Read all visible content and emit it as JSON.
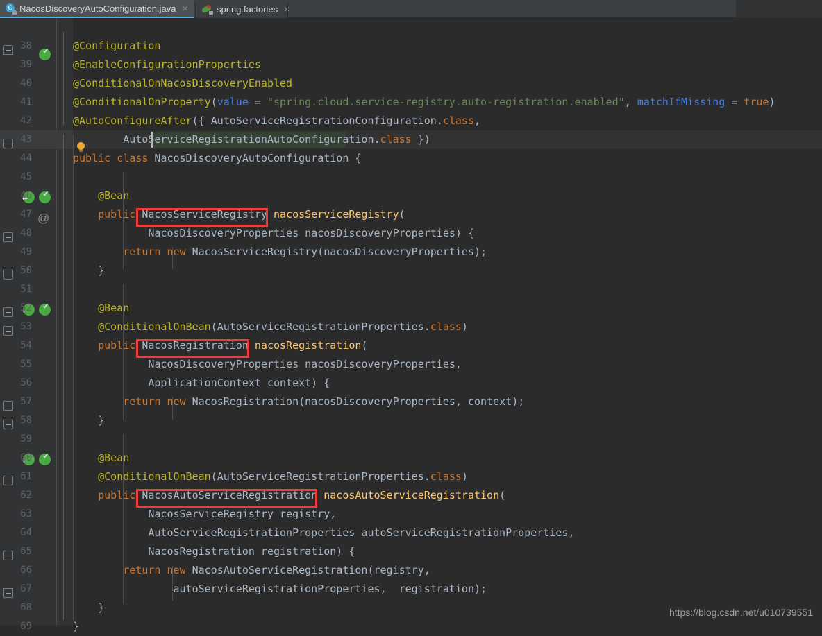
{
  "window": {
    "title": "NacosDiscoveryAutoConfiguration.java",
    "theme": "darcula"
  },
  "tabs": [
    {
      "label": "NacosDiscoveryAutoConfiguration.java",
      "icon": "java-class-icon",
      "active": true,
      "close": "×"
    },
    {
      "label": "spring.factories",
      "icon": "spring-leaf-icon",
      "active": false,
      "close": "×"
    }
  ],
  "editor": {
    "first_line": 38,
    "last_line": 69,
    "current_line": 44,
    "line_numbers": [
      38,
      39,
      40,
      41,
      42,
      43,
      44,
      45,
      46,
      47,
      48,
      49,
      50,
      51,
      52,
      53,
      54,
      55,
      56,
      57,
      58,
      59,
      60,
      61,
      62,
      63,
      64,
      65,
      66,
      67,
      68,
      69
    ],
    "lines": [
      {
        "n": 38,
        "text": "@Configuration"
      },
      {
        "n": 39,
        "text": "@EnableConfigurationProperties"
      },
      {
        "n": 40,
        "text": "@ConditionalOnNacosDiscoveryEnabled"
      },
      {
        "n": 41,
        "text": "@ConditionalOnProperty(value = \"spring.cloud.service-registry.auto-registration.enabled\", matchIfMissing = true)"
      },
      {
        "n": 42,
        "text": "@AutoConfigureAfter({ AutoServiceRegistrationConfiguration.class,"
      },
      {
        "n": 43,
        "text": "        AutoServiceRegistrationAutoConfiguration.class })"
      },
      {
        "n": 44,
        "text": "public class NacosDiscoveryAutoConfiguration {"
      },
      {
        "n": 45,
        "text": ""
      },
      {
        "n": 46,
        "text": "    @Bean"
      },
      {
        "n": 47,
        "text": "    public NacosServiceRegistry nacosServiceRegistry("
      },
      {
        "n": 48,
        "text": "            NacosDiscoveryProperties nacosDiscoveryProperties) {"
      },
      {
        "n": 49,
        "text": "        return new NacosServiceRegistry(nacosDiscoveryProperties);"
      },
      {
        "n": 50,
        "text": "    }"
      },
      {
        "n": 51,
        "text": ""
      },
      {
        "n": 52,
        "text": "    @Bean"
      },
      {
        "n": 53,
        "text": "    @ConditionalOnBean(AutoServiceRegistrationProperties.class)"
      },
      {
        "n": 54,
        "text": "    public NacosRegistration nacosRegistration("
      },
      {
        "n": 55,
        "text": "            NacosDiscoveryProperties nacosDiscoveryProperties,"
      },
      {
        "n": 56,
        "text": "            ApplicationContext context) {"
      },
      {
        "n": 57,
        "text": "        return new NacosRegistration(nacosDiscoveryProperties, context);"
      },
      {
        "n": 58,
        "text": "    }"
      },
      {
        "n": 59,
        "text": ""
      },
      {
        "n": 60,
        "text": "    @Bean"
      },
      {
        "n": 61,
        "text": "    @ConditionalOnBean(AutoServiceRegistrationProperties.class)"
      },
      {
        "n": 62,
        "text": "    public NacosAutoServiceRegistration nacosAutoServiceRegistration("
      },
      {
        "n": 63,
        "text": "            NacosServiceRegistry registry,"
      },
      {
        "n": 64,
        "text": "            AutoServiceRegistrationProperties autoServiceRegistrationProperties,"
      },
      {
        "n": 65,
        "text": "            NacosRegistration registration) {"
      },
      {
        "n": 66,
        "text": "        return new NacosAutoServiceRegistration(registry,"
      },
      {
        "n": 67,
        "text": "                autoServiceRegistrationProperties, registration);"
      },
      {
        "n": 68,
        "text": "    }"
      },
      {
        "n": 69,
        "text": "}"
      }
    ],
    "highlighted_symbols": [
      {
        "line": 47,
        "text": "NacosServiceRegistry"
      },
      {
        "line": 54,
        "text": "NacosRegistration"
      },
      {
        "line": 62,
        "text": "NacosAutoServiceRegistration"
      }
    ],
    "gutter_icons": [
      {
        "line": 38,
        "icons": [
          "overridden-check-icon"
        ]
      },
      {
        "line": 46,
        "icons": [
          "implemented-arrow-icon",
          "overridden-check-icon"
        ]
      },
      {
        "line": 47,
        "icons": [
          "annotation-at-icon"
        ]
      },
      {
        "line": 52,
        "icons": [
          "implemented-arrow-icon",
          "overridden-check-icon"
        ]
      },
      {
        "line": 60,
        "icons": [
          "implemented-arrow-icon",
          "overridden-check-icon"
        ]
      }
    ],
    "inspection_hint": {
      "line": 43,
      "icon": "lightbulb-icon"
    }
  },
  "colors": {
    "background": "#2b2b2b",
    "gutter": "#313335",
    "tabbar": "#3c3f41",
    "active_tab": "#4e5254",
    "accent": "#4eade5",
    "keyword": "#cc7832",
    "annotation": "#bbb529",
    "string": "#6a8759",
    "method": "#ffc66d",
    "identifier": "#a9b7c6",
    "number": "#6897bb",
    "parameter": "#9876aa",
    "annotation_box": "#f03b3b",
    "line_number": "#606366"
  },
  "watermark": "https://blog.csdn.net/u010739551"
}
